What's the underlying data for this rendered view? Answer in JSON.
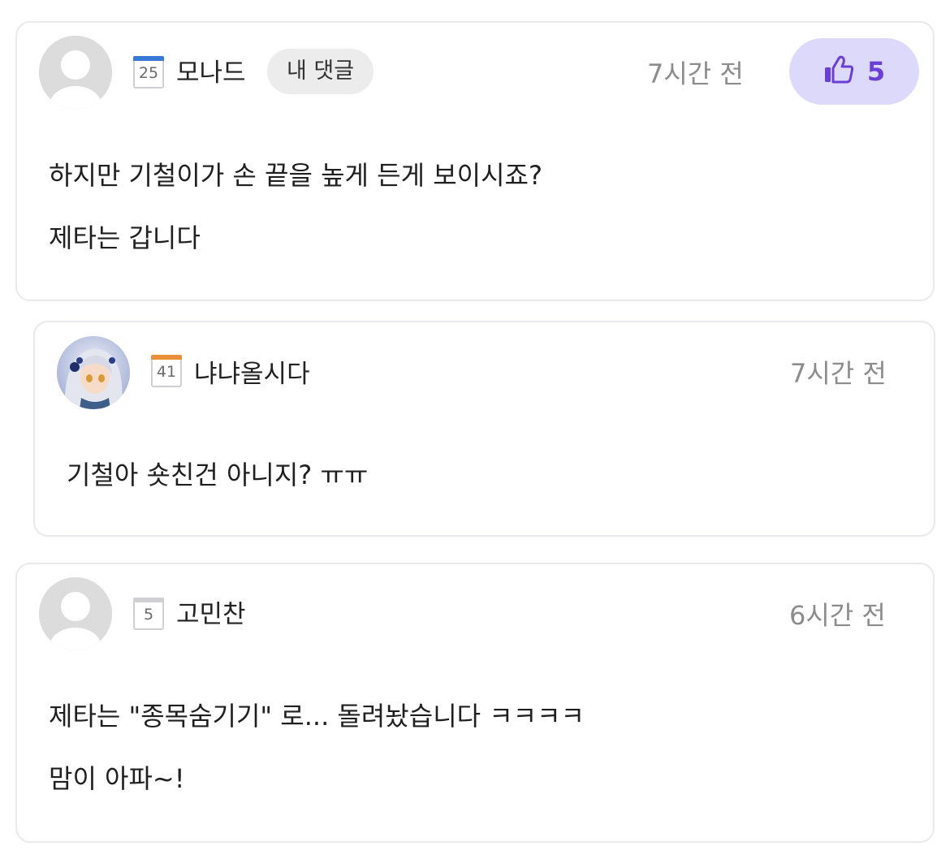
{
  "comments": [
    {
      "username": "모나드",
      "level": "25",
      "level_color": "#3a78d6",
      "my_tag": "내 댓글",
      "time": "7시간 전",
      "likes": "5",
      "like_icon": "thumbs-up-icon",
      "avatar": "default-avatar",
      "lines": [
        "하지만 기철이가 손 끝을 높게 든게 보이시죠?",
        "제타는 갑니다"
      ]
    },
    {
      "username": "냐냐올시다",
      "level": "41",
      "level_color": "#e98f3c",
      "time": "7시간 전",
      "avatar": "character-avatar",
      "lines": [
        "기철아 숏친건 아니지? ㅠㅠ"
      ]
    },
    {
      "username": "고민찬",
      "level": "5",
      "level_color": "#cfcfd4",
      "time": "6시간 전",
      "avatar": "default-avatar",
      "lines": [
        "제타는 \"종목숨기기\" 로... 돌려놨습니다 ㅋㅋㅋㅋ",
        "맘이 아파~!"
      ]
    }
  ],
  "colors": {
    "like_bg": "#ddd9fb",
    "like_fg": "#6b3fd6",
    "border": "#e9e9ee",
    "time": "#8c8c8c"
  }
}
